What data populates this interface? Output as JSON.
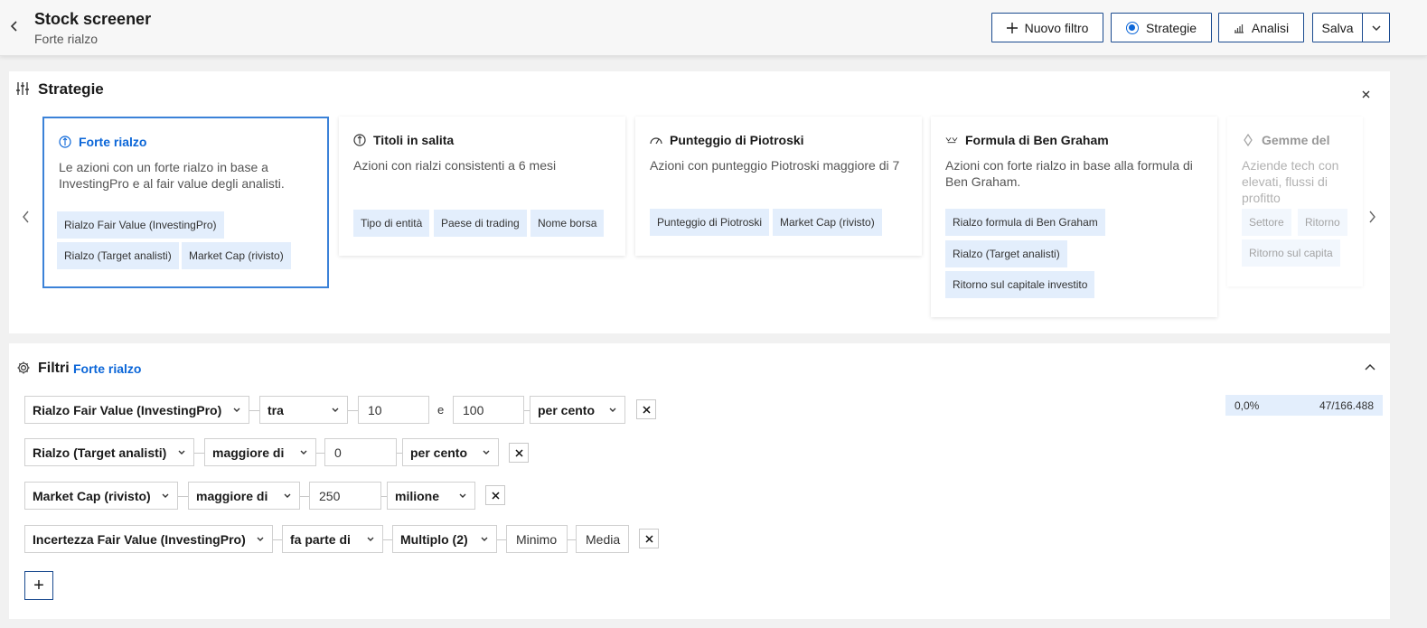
{
  "header": {
    "title": "Stock screener",
    "subtitle": "Forte rialzo",
    "new_filter": "Nuovo filtro",
    "strategies": "Strategie",
    "analysis": "Analisi",
    "save": "Salva"
  },
  "strategies": {
    "title": "Strategie",
    "cards": [
      {
        "title": "Forte rialzo",
        "desc": "Le azioni con un forte rialzo in base a InvestingPro e al fair value degli analisti.",
        "tags": [
          "Rialzo Fair Value (InvestingPro)",
          "Rialzo (Target analisti)",
          "Market Cap (rivisto)"
        ]
      },
      {
        "title": "Titoli in salita",
        "desc": "Azioni con rialzi consistenti a 6 mesi",
        "tags": [
          "Tipo di entità",
          "Paese di trading",
          "Nome borsa"
        ]
      },
      {
        "title": "Punteggio di Piotroski",
        "desc": "Azioni con punteggio Piotroski maggiore di 7",
        "tags": [
          "Punteggio di Piotroski",
          "Market Cap (rivisto)"
        ]
      },
      {
        "title": "Formula di Ben Graham",
        "desc": "Azioni con forte rialzo in base alla formula di Ben Graham.",
        "tags": [
          "Rialzo formula di Ben Graham",
          "Rialzo (Target analisti)",
          "Ritorno sul capitale investito"
        ]
      },
      {
        "title": "Gemme del",
        "desc": "Aziende tech con elevati, flussi di profitto",
        "tags": [
          "Settore",
          "Ritorno",
          "Ritorno sul capita"
        ]
      }
    ]
  },
  "filters": {
    "title": "Filtri",
    "strategy_name": "Forte rialzo",
    "result_pct": "0,0%",
    "result_count": "47/166.488",
    "and_label": "e",
    "rows": [
      {
        "field": "Rialzo Fair Value (InvestingPro)",
        "op": "tra",
        "v1": "10",
        "v2": "100",
        "unit": "per cento"
      },
      {
        "field": "Rialzo (Target analisti)",
        "op": "maggiore di",
        "v1": "0",
        "unit": "per cento"
      },
      {
        "field": "Market Cap (rivisto)",
        "op": "maggiore di",
        "v1": "250",
        "unit": "milione"
      },
      {
        "field": "Incertezza Fair Value (InvestingPro)",
        "op": "fa parte di",
        "multi": "Multiplo (2)",
        "chip1": "Minimo",
        "chip2": "Media"
      }
    ],
    "add_symbol": "+"
  },
  "colors": {
    "accent": "#0b66d8",
    "tag_bg": "#e3eefc",
    "border": "#1a4a8f"
  }
}
